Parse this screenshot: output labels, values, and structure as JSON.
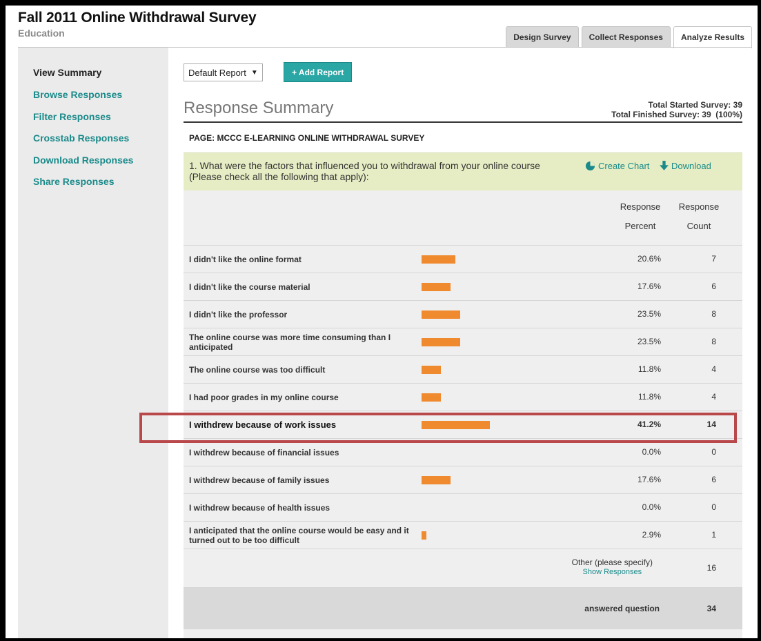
{
  "header": {
    "title": "Fall 2011 Online Withdrawal Survey",
    "subtitle": "Education",
    "tabs": [
      {
        "label": "Design Survey",
        "active": false
      },
      {
        "label": "Collect Responses",
        "active": false
      },
      {
        "label": "Analyze Results",
        "active": true
      }
    ]
  },
  "sidebar": {
    "items": [
      {
        "label": "View Summary",
        "current": true
      },
      {
        "label": "Browse Responses",
        "current": false
      },
      {
        "label": "Filter Responses",
        "current": false
      },
      {
        "label": "Crosstab Responses",
        "current": false
      },
      {
        "label": "Download Responses",
        "current": false
      },
      {
        "label": "Share Responses",
        "current": false
      }
    ]
  },
  "toolbar": {
    "report_select": "Default Report",
    "add_report_label": "+ Add Report"
  },
  "summary": {
    "title": "Response Summary",
    "total_started": "Total Started Survey: 39",
    "total_finished": "Total Finished Survey: 39  (100%)",
    "page_label": "PAGE: MCCC E-LEARNING ONLINE WITHDRAWAL SURVEY"
  },
  "question": {
    "text": "1. What were the factors that influenced you to withdrawal from your online course (Please check all the following that apply):",
    "create_chart_label": "Create Chart",
    "download_label": "Download"
  },
  "table": {
    "col_percent": [
      "Response",
      "Percent"
    ],
    "col_count": [
      "Response",
      "Count"
    ],
    "rows": [
      {
        "label": "I didn't like the online format",
        "percent": "20.6%",
        "value": 20.6,
        "count": "7"
      },
      {
        "label": "I didn't like the course material",
        "percent": "17.6%",
        "value": 17.6,
        "count": "6"
      },
      {
        "label": "I didn't like the professor",
        "percent": "23.5%",
        "value": 23.5,
        "count": "8"
      },
      {
        "label": "The online course was more time consuming than I anticipated",
        "percent": "23.5%",
        "value": 23.5,
        "count": "8"
      },
      {
        "label": "The online course was too difficult",
        "percent": "11.8%",
        "value": 11.8,
        "count": "4"
      },
      {
        "label": "I had poor grades in my online course",
        "percent": "11.8%",
        "value": 11.8,
        "count": "4"
      },
      {
        "label": "I withdrew because of work issues",
        "percent": "41.2%",
        "value": 41.2,
        "count": "14",
        "highlight": true
      },
      {
        "label": "I withdrew because of financial issues",
        "percent": "0.0%",
        "value": 0.0,
        "count": "0"
      },
      {
        "label": "I withdrew because of family issues",
        "percent": "17.6%",
        "value": 17.6,
        "count": "6"
      },
      {
        "label": "I withdrew because of health issues",
        "percent": "0.0%",
        "value": 0.0,
        "count": "0"
      },
      {
        "label": "I anticipated that the online course would be easy and it turned out to be too difficult",
        "percent": "2.9%",
        "value": 2.9,
        "count": "1"
      }
    ],
    "other_label": "Other (please specify)",
    "show_responses_label": "Show Responses",
    "other_count": "16",
    "answered_label": "answered question",
    "answered_count": "34"
  },
  "colors": {
    "accent": "#1a8a8a",
    "bar": "#f08a2f",
    "highlight_border": "#b9484b",
    "question_bg": "#e6edc4"
  }
}
